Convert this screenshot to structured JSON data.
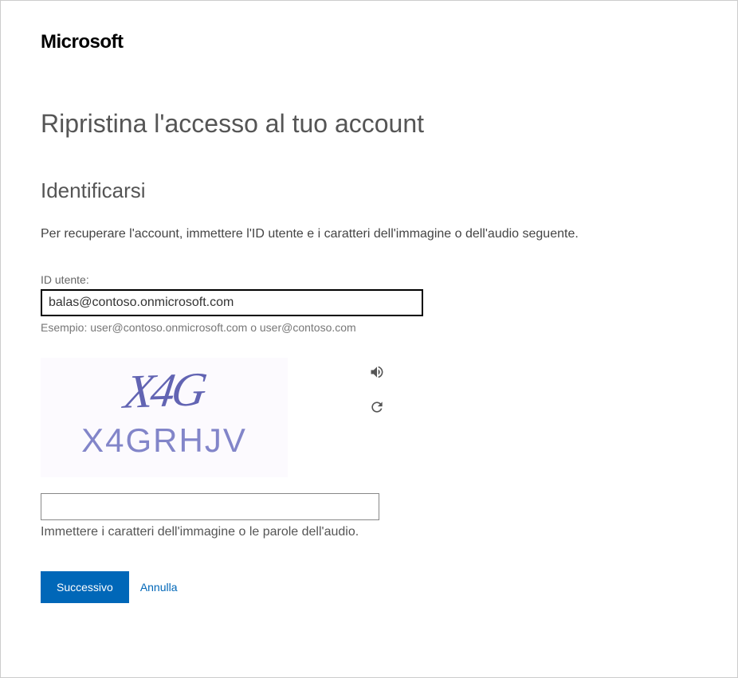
{
  "brand": "Microsoft",
  "page_title": "Ripristina l'accesso al tuo account",
  "subtitle": "Identificarsi",
  "instructions": "Per recuperare l'account, immettere l'ID utente e i caratteri dell'immagine o dell'audio seguente.",
  "user_id_field": {
    "label": "ID utente:",
    "value": "balas@contoso.onmicrosoft.com",
    "example": "Esempio:  user@contoso.onmicrosoft.com  o  user@contoso.com"
  },
  "captcha": {
    "distorted_text": "X4G",
    "clear_text": "X4GRHJV",
    "input_value": "",
    "hint": "Immettere i caratteri dell'immagine o le parole dell'audio."
  },
  "buttons": {
    "next": "Successivo",
    "cancel": "Annulla"
  }
}
